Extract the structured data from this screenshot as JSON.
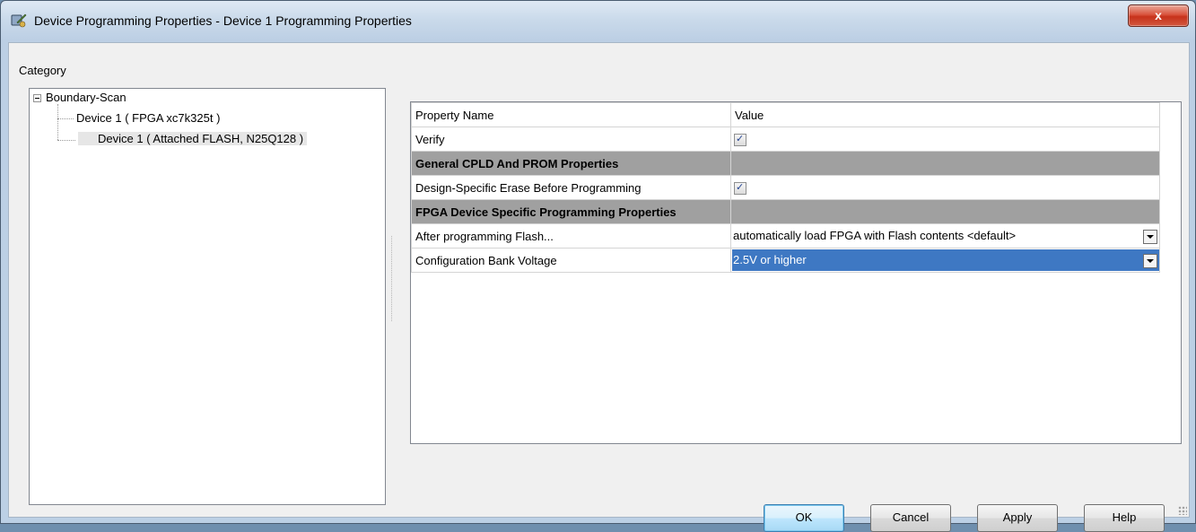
{
  "window": {
    "title": "Device Programming Properties - Device 1 Programming Properties",
    "close_glyph": "x",
    "app_icon": "device-programming-icon"
  },
  "category": {
    "label": "Category",
    "tree": {
      "root": "Boundary-Scan",
      "children": [
        "Device 1 ( FPGA xc7k325t )",
        "Device 1 ( Attached FLASH, N25Q128 )"
      ]
    }
  },
  "properties": {
    "headers": {
      "name": "Property Name",
      "value": "Value"
    },
    "rows": [
      {
        "name": "Verify",
        "checked": true
      },
      {
        "section": "General CPLD And PROM Properties"
      },
      {
        "name": "Design-Specific Erase Before Programming",
        "checked": true
      },
      {
        "section": "FPGA Device Specific Programming Properties"
      },
      {
        "name": "After programming Flash...",
        "value": "automatically load FPGA with Flash contents <default>"
      },
      {
        "name": "Configuration Bank Voltage",
        "value": "2.5V or higher"
      }
    ],
    "checkmark": "✓"
  },
  "buttons": {
    "ok": "OK",
    "cancel": "Cancel",
    "apply": "Apply",
    "help": "Help"
  },
  "colors": {
    "selection": "#3e78c3",
    "section_bg": "#a0a0a0",
    "close_red": "#c7321b"
  }
}
